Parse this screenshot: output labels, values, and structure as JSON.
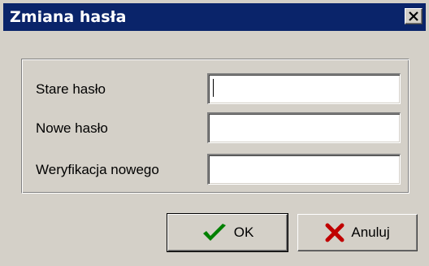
{
  "window": {
    "title": "Zmiana hasła",
    "close_icon": "close-icon"
  },
  "form": {
    "fields": [
      {
        "label": "Stare hasło",
        "value": ""
      },
      {
        "label": "Nowe hasło",
        "value": ""
      },
      {
        "label": "Weryfikacja nowego",
        "value": ""
      }
    ]
  },
  "buttons": {
    "ok": {
      "label": "OK",
      "icon": "checkmark-icon",
      "accent": "#008000"
    },
    "cancel": {
      "label": "Anuluj",
      "icon": "x-icon",
      "accent": "#c00000"
    }
  },
  "colors": {
    "titlebar": "#0a246a",
    "face": "#d4d0c8"
  }
}
